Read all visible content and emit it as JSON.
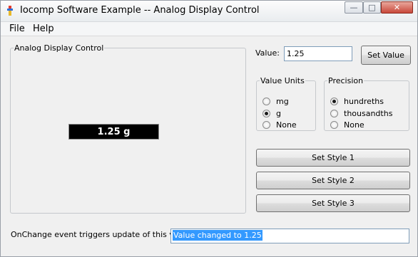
{
  "window": {
    "title": "Iocomp Software Example -- Analog Display Control",
    "controls": {
      "minimize": "—",
      "maximize": "□",
      "close": "✕"
    }
  },
  "menu": {
    "items": [
      "File",
      "Help"
    ]
  },
  "display_group": {
    "legend": "Analog Display Control",
    "display_text": "1.25 g"
  },
  "value": {
    "label": "Value:",
    "input_value": "1.25",
    "set_button": "Set Value"
  },
  "units": {
    "legend": "Value Units",
    "options": [
      "mg",
      "g",
      "None"
    ],
    "selected": "g"
  },
  "precision": {
    "legend": "Precision",
    "options": [
      "hundreths",
      "thousandths",
      "None"
    ],
    "selected": "hundreths"
  },
  "style_buttons": [
    "Set Style 1",
    "Set Style 2",
    "Set Style 3"
  ],
  "event": {
    "label": "OnChange event triggers update of this value:",
    "value": "Value changed to 1.25"
  },
  "colors": {
    "display_bg": "#000000",
    "display_fg": "#ffffff",
    "selection": "#3399ff",
    "close_button": "#c9483a"
  }
}
